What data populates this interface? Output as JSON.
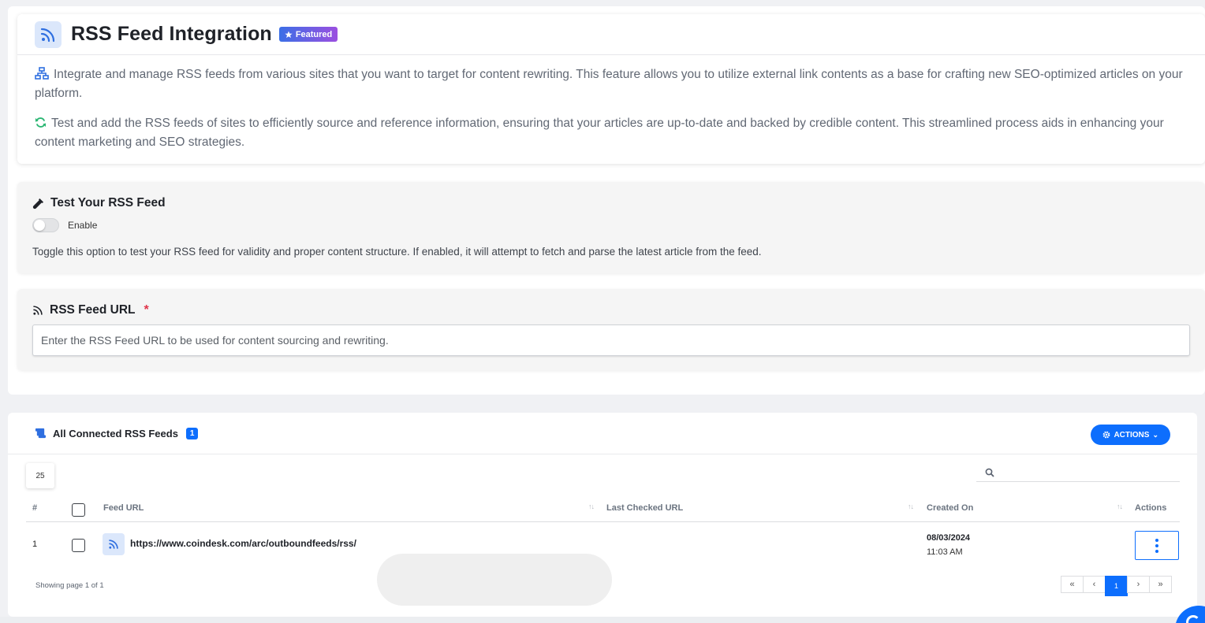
{
  "header": {
    "title": "RSS Feed Integration",
    "badge": "Featured",
    "desc1": "Integrate and manage RSS feeds from various sites that you want to target for content rewriting. This feature allows you to utilize external link contents as a base for crafting new SEO-optimized articles on your platform.",
    "desc2": "Test and add the RSS feeds of sites to efficiently source and reference information, ensuring that your articles are up-to-date and backed by credible content. This streamlined process aids in enhancing your content marketing and SEO strategies."
  },
  "test_section": {
    "title": "Test Your RSS Feed",
    "toggle_label": "Enable",
    "toggle_on": false,
    "help": "Toggle this option to test your RSS feed for validity and proper content structure. If enabled, it will attempt to fetch and parse the latest article from the feed."
  },
  "url_section": {
    "title": "RSS Feed URL",
    "required_mark": "*",
    "placeholder": "Enter the RSS Feed URL to be used for content sourcing and rewriting."
  },
  "feeds": {
    "title": "All Connected RSS Feeds",
    "count": "1",
    "actions_label": "ACTIONS",
    "per_page": "25",
    "search_placeholder": "",
    "columns": {
      "num": "#",
      "feed_url": "Feed URL",
      "last_checked": "Last Checked URL",
      "created_on": "Created On",
      "actions": "Actions"
    },
    "rows": [
      {
        "num": "1",
        "feed_url": "https://www.coindesk.com/arc/outboundfeeds/rss/",
        "last_checked": "",
        "date": "08/03/2024",
        "time": "11:03 AM"
      }
    ],
    "showing": "Showing page 1 of 1",
    "pagination": {
      "first": "«",
      "prev": "‹",
      "current": "1",
      "next": "›",
      "last": "»"
    }
  },
  "colors": {
    "accent": "#0d6efd",
    "badge_gradient_start": "#3b6fe6",
    "badge_gradient_end": "#9b4fe0",
    "required": "#e0344a",
    "refresh_icon": "#2bb673"
  }
}
